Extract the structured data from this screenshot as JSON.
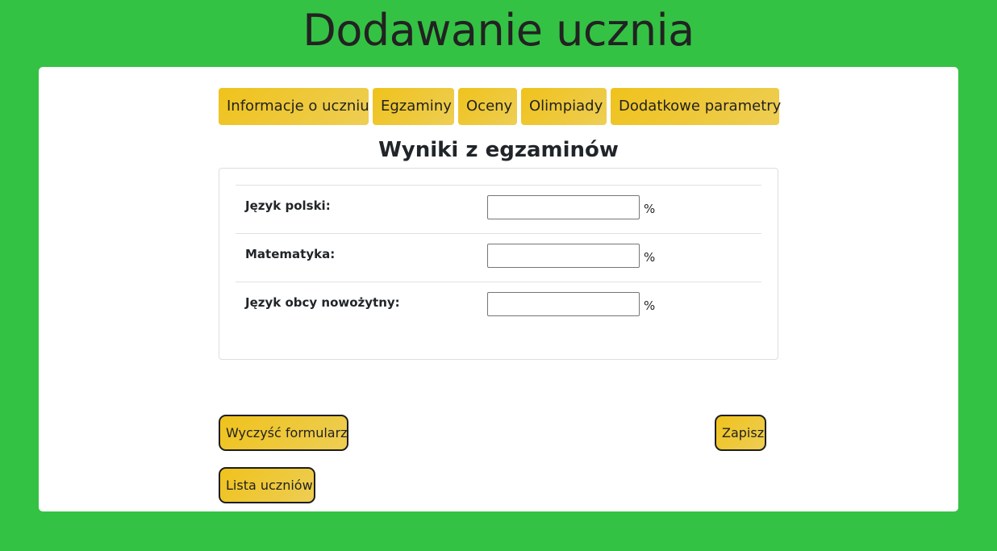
{
  "header": {
    "title": "Dodawanie ucznia"
  },
  "tabs": [
    {
      "label": "Informacje o uczniu"
    },
    {
      "label": "Egzaminy"
    },
    {
      "label": "Oceny"
    },
    {
      "label": "Olimpiady"
    },
    {
      "label": "Dodatkowe parametry"
    }
  ],
  "exams": {
    "title": "Wyniki z egzaminów",
    "rows": [
      {
        "label": "Język polski:",
        "value": "",
        "unit": "%"
      },
      {
        "label": "Matematyka:",
        "value": "",
        "unit": "%"
      },
      {
        "label": "Język obcy nowożytny:",
        "value": "",
        "unit": "%"
      }
    ]
  },
  "actions": {
    "clear_label": "Wyczyść formularz",
    "save_label": "Zapisz",
    "list_label": "Lista uczniów"
  },
  "colors": {
    "background": "#34c244",
    "card": "#ffffff",
    "accent": "#efc21c"
  }
}
